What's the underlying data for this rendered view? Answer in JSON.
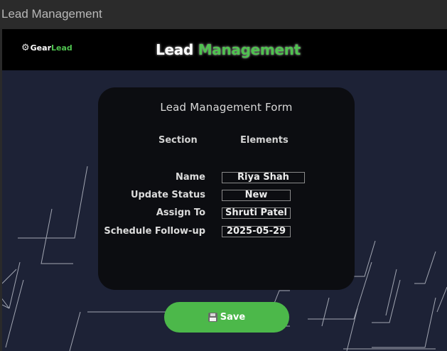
{
  "window": {
    "title": "Lead Management"
  },
  "header": {
    "logo_prefix": "Gear",
    "logo_accent": "Lead",
    "title_white": "Lead",
    "title_green": "Management"
  },
  "form": {
    "title": "Lead Management Form",
    "col_section": "Section",
    "col_elements": "Elements",
    "fields": [
      {
        "label": "Name",
        "value": "Riya Shah"
      },
      {
        "label": "Update Status",
        "value": "New"
      },
      {
        "label": "Assign To",
        "value": "Shruti Patel"
      },
      {
        "label": "Schedule Follow-up",
        "value": "2025-05-29"
      }
    ]
  },
  "actions": {
    "save_label": "Save",
    "save_icon": "floppy-disk-icon"
  },
  "colors": {
    "accent": "#4cb84a",
    "background": "#1d2236",
    "card": "#0c0d11",
    "header": "#000000"
  }
}
